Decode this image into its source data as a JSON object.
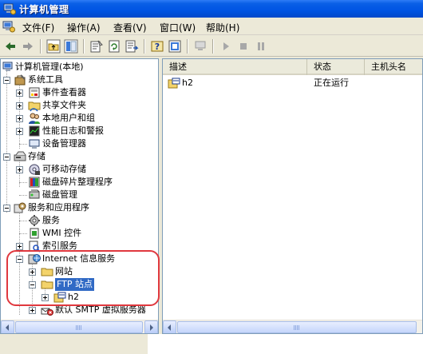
{
  "window": {
    "title": "计算机管理"
  },
  "menu": [
    {
      "label": "文件(F)"
    },
    {
      "label": "操作(A)"
    },
    {
      "label": "查看(V)"
    },
    {
      "label": "窗口(W)"
    },
    {
      "label": "帮助(H)"
    }
  ],
  "toolbar": {
    "buttons": [
      "back-icon",
      "forward-icon",
      "up-folder-icon",
      "show-hide-tree-icon",
      "properties-icon",
      "refresh-icon",
      "export-list-icon",
      "help-icon",
      "console-icon",
      "computer-icon",
      "start-icon",
      "stop-icon",
      "pause-icon"
    ]
  },
  "tree": {
    "root": "计算机管理(本地)",
    "system_tools": "系统工具",
    "event_viewer": "事件查看器",
    "shared_folders": "共享文件夹",
    "local_users": "本地用户和组",
    "perf_logs": "性能日志和警报",
    "device_manager": "设备管理器",
    "storage": "存储",
    "removable_storage": "可移动存储",
    "defrag": "磁盘碎片整理程序",
    "disk_mgmt": "磁盘管理",
    "services_apps": "服务和应用程序",
    "services": "服务",
    "wmi": "WMI 控件",
    "indexing": "索引服务",
    "iis": "Internet 信息服务",
    "websites": "网站",
    "ftp_sites": "FTP 站点",
    "h2": "h2",
    "smtp": "默认 SMTP 虚拟服务器"
  },
  "list": {
    "columns": [
      {
        "label": "描述"
      },
      {
        "label": "状态"
      },
      {
        "label": "主机头名"
      }
    ],
    "rows": [
      {
        "description": "h2",
        "status": "正在运行",
        "host": ""
      }
    ]
  },
  "colors": {
    "titlebar": "#0054e3",
    "selection": "#316ac5",
    "annotation": "#e0383e"
  }
}
